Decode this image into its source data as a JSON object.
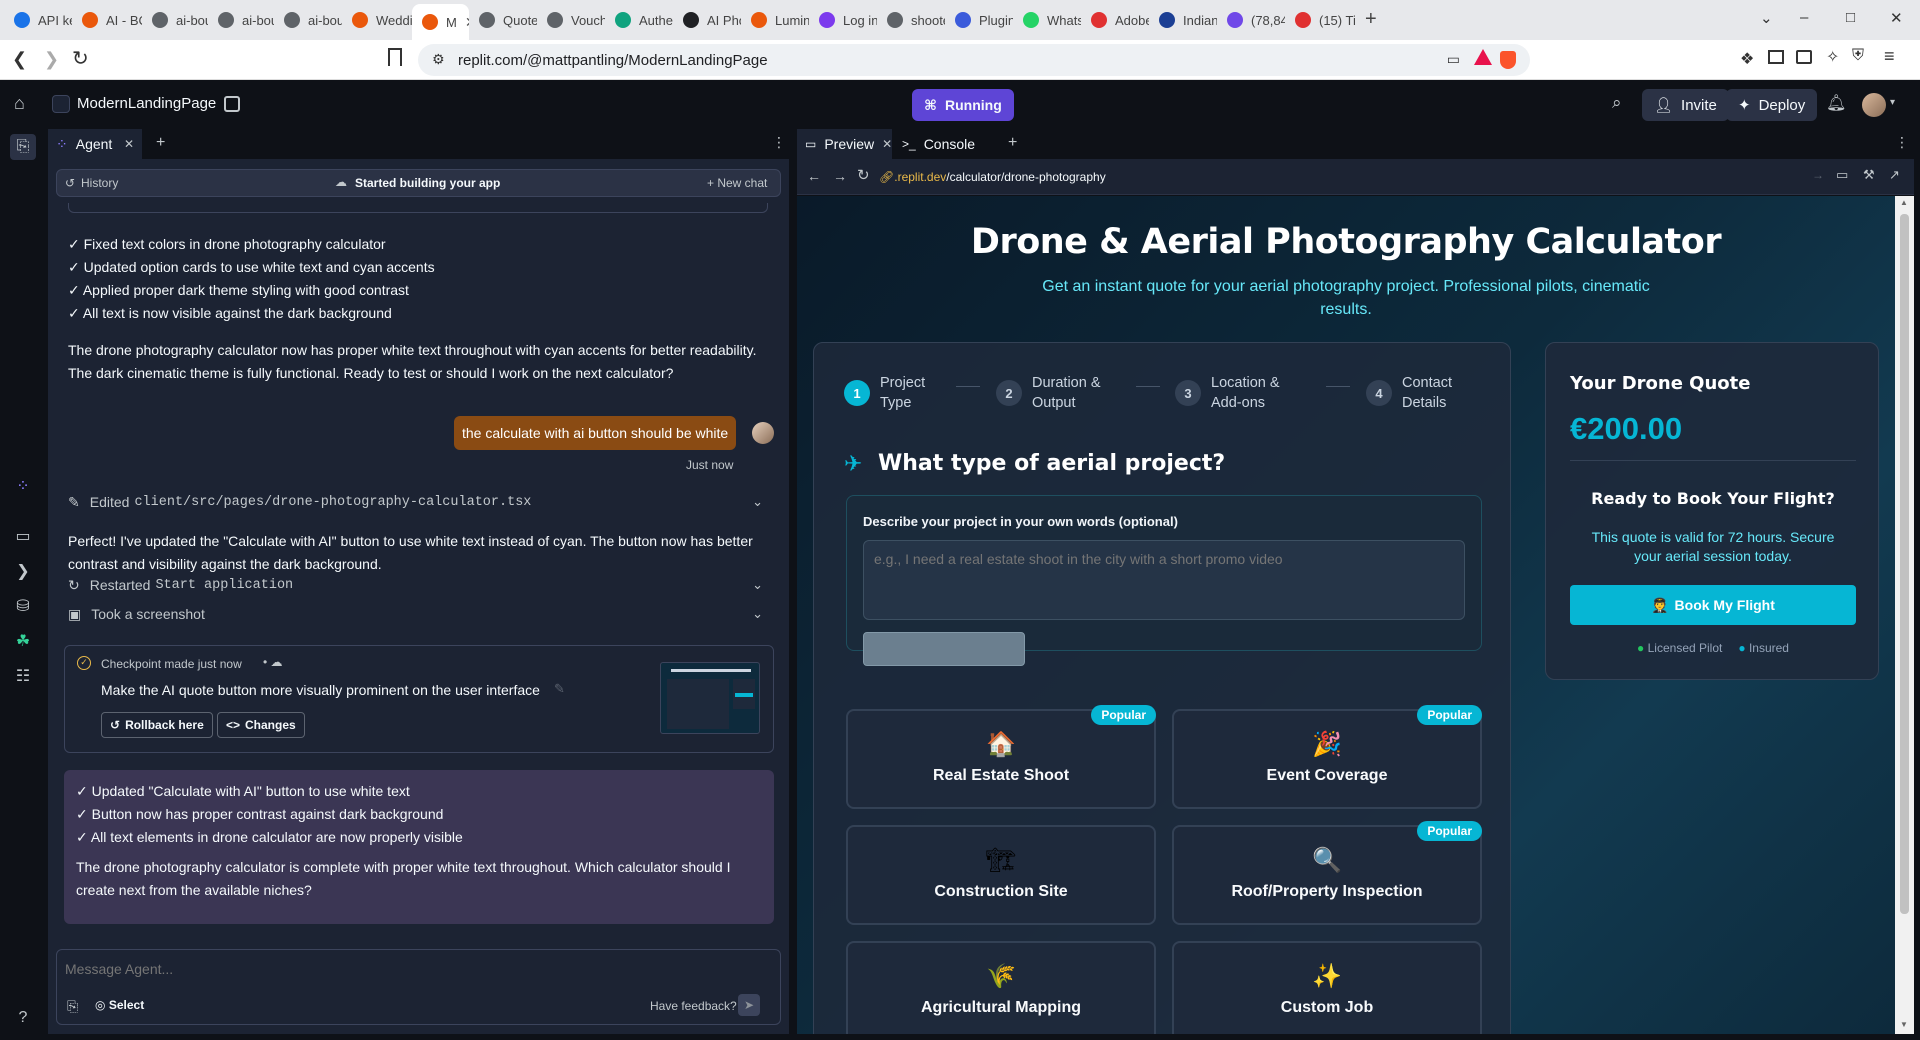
{
  "browser": {
    "tabs": [
      {
        "label": "API ke",
        "color": "#1a73e8",
        "icon": "globe-icon"
      },
      {
        "label": "AI - BC",
        "color": "#ea580c",
        "icon": "replit-icon"
      },
      {
        "label": "ai-bou",
        "color": "#5f6368",
        "icon": "globe-icon"
      },
      {
        "label": "ai-bou",
        "color": "#5f6368",
        "icon": "globe-icon"
      },
      {
        "label": "ai-bou",
        "color": "#5f6368",
        "icon": "globe-icon"
      },
      {
        "label": "Weddi",
        "color": "#ea580c",
        "icon": "replit-icon"
      },
      {
        "label": "M",
        "color": "#ea580c",
        "icon": "replit-icon"
      },
      {
        "label": "Quote",
        "color": "#5f6368",
        "icon": "globe-icon"
      },
      {
        "label": "Vouch",
        "color": "#5f6368",
        "icon": "globe-icon"
      },
      {
        "label": "Authe",
        "color": "#10a37f",
        "icon": "auth-icon"
      },
      {
        "label": "AI Pho",
        "color": "#202124",
        "icon": "openai-icon"
      },
      {
        "label": "Lumin",
        "color": "#ea580c",
        "icon": "replit-icon"
      },
      {
        "label": "Log in",
        "color": "#7c3aed",
        "icon": "slash-icon"
      },
      {
        "label": "shoote",
        "color": "#5f6368",
        "icon": "globe-icon"
      },
      {
        "label": "Plugin",
        "color": "#3b5bdb",
        "icon": "wordpress-icon"
      },
      {
        "label": "Whats",
        "color": "#25d366",
        "icon": "whatsapp-icon"
      },
      {
        "label": "Adobe",
        "color": "#e03131",
        "icon": "adobe-icon"
      },
      {
        "label": "Indian",
        "color": "#1c3f94",
        "icon": "news-icon"
      },
      {
        "label": "(78,84",
        "color": "#7048e8",
        "icon": "mail-icon"
      },
      {
        "label": "(15) Ti",
        "color": "#e03131",
        "icon": "youtube-icon"
      }
    ],
    "new_tab": "+",
    "url": "replit.com/@mattpantling/ModernLandingPage"
  },
  "replit": {
    "project_name": "ModernLandingPage",
    "run_status": "Running",
    "invite_label": "Invite",
    "deploy_label": "Deploy"
  },
  "agent": {
    "tab_label": "Agent",
    "history_label": "History",
    "status_label": "Started building your app",
    "new_chat_label": "New chat",
    "summary_lines": [
      "✓ Fixed text colors in drone photography calculator",
      "✓ Updated option cards to use white text and cyan accents",
      "✓ Applied proper dark theme styling with good contrast",
      "✓ All text is now visible against the dark background"
    ],
    "summary_para": "The drone photography calculator now has proper white text throughout with cyan accents for better readability. The dark cinematic theme is fully functional. Ready to test or should I work on the next calculator?",
    "user_message": "the calculate with ai button should be white",
    "user_time": "Just now",
    "edited_prefix": "Edited",
    "edited_file": "client/src/pages/drone-photography-calculator.tsx",
    "reply_para": "Perfect! I've updated the \"Calculate with AI\" button to use white text instead of cyan. The button now has better contrast and visibility against the dark background.",
    "restarted_prefix": "Restarted",
    "restarted_name": "Start application",
    "screenshot_label": "Took a screenshot",
    "checkpoint_title": "Checkpoint made just now",
    "checkpoint_desc": "Make the AI quote button more visually prominent on the user interface",
    "rollback_label": "Rollback here",
    "changes_label": "Changes",
    "final_lines": [
      "✓ Updated \"Calculate with AI\" button to use white text",
      "✓ Button now has proper contrast against dark background",
      "✓ All text elements in drone calculator are now properly visible"
    ],
    "final_para": "The drone photography calculator is complete with proper white text throughout. Which calculator should I create next from the available niches?",
    "composer_placeholder": "Message Agent...",
    "select_label": "Select",
    "feedback_label": "Have feedback?"
  },
  "preview": {
    "tab_preview": "Preview",
    "tab_console": "Console",
    "url_domain": ".replit.dev",
    "url_path": "/calculator/drone-photography"
  },
  "site": {
    "title": "Drone & Aerial Photography Calculator",
    "subtitle_line1": "Get an instant quote for your aerial photography project. Professional pilots, cinematic",
    "subtitle_line2": "results.",
    "steps": [
      {
        "num": "1",
        "line1": "Project",
        "line2": "Type"
      },
      {
        "num": "2",
        "line1": "Duration &",
        "line2": "Output"
      },
      {
        "num": "3",
        "line1": "Location &",
        "line2": "Add-ons"
      },
      {
        "num": "4",
        "line1": "Contact",
        "line2": "Details"
      }
    ],
    "question": "What type of aerial project?",
    "describe_label": "Describe your project in your own words (optional)",
    "describe_placeholder": "e.g., I need a real estate shoot in the city with a short promo video",
    "options": [
      {
        "label": "Real Estate Shoot",
        "icon": "🏠",
        "popular": true
      },
      {
        "label": "Event Coverage",
        "icon": "🎉",
        "popular": true
      },
      {
        "label": "Construction Site",
        "icon": "🏗",
        "popular": false
      },
      {
        "label": "Roof/Property Inspection",
        "icon": "🔍",
        "popular": true
      },
      {
        "label": "Agricultural Mapping",
        "icon": "🌾",
        "popular": false
      },
      {
        "label": "Custom Job",
        "icon": "✨",
        "popular": false
      }
    ],
    "popular_label": "Popular",
    "quote_title": "Your Drone Quote",
    "quote_amount": "€200.00",
    "ready_title": "Ready to Book Your Flight?",
    "ready_text_line1": "This quote is valid for 72 hours. Secure",
    "ready_text_line2": "your aerial session today.",
    "book_label": "Book My Flight",
    "book_icon": "🧑‍✈️",
    "badge1": "Licensed Pilot",
    "badge2": "Insured",
    "accent_color": "#06b6d4"
  }
}
